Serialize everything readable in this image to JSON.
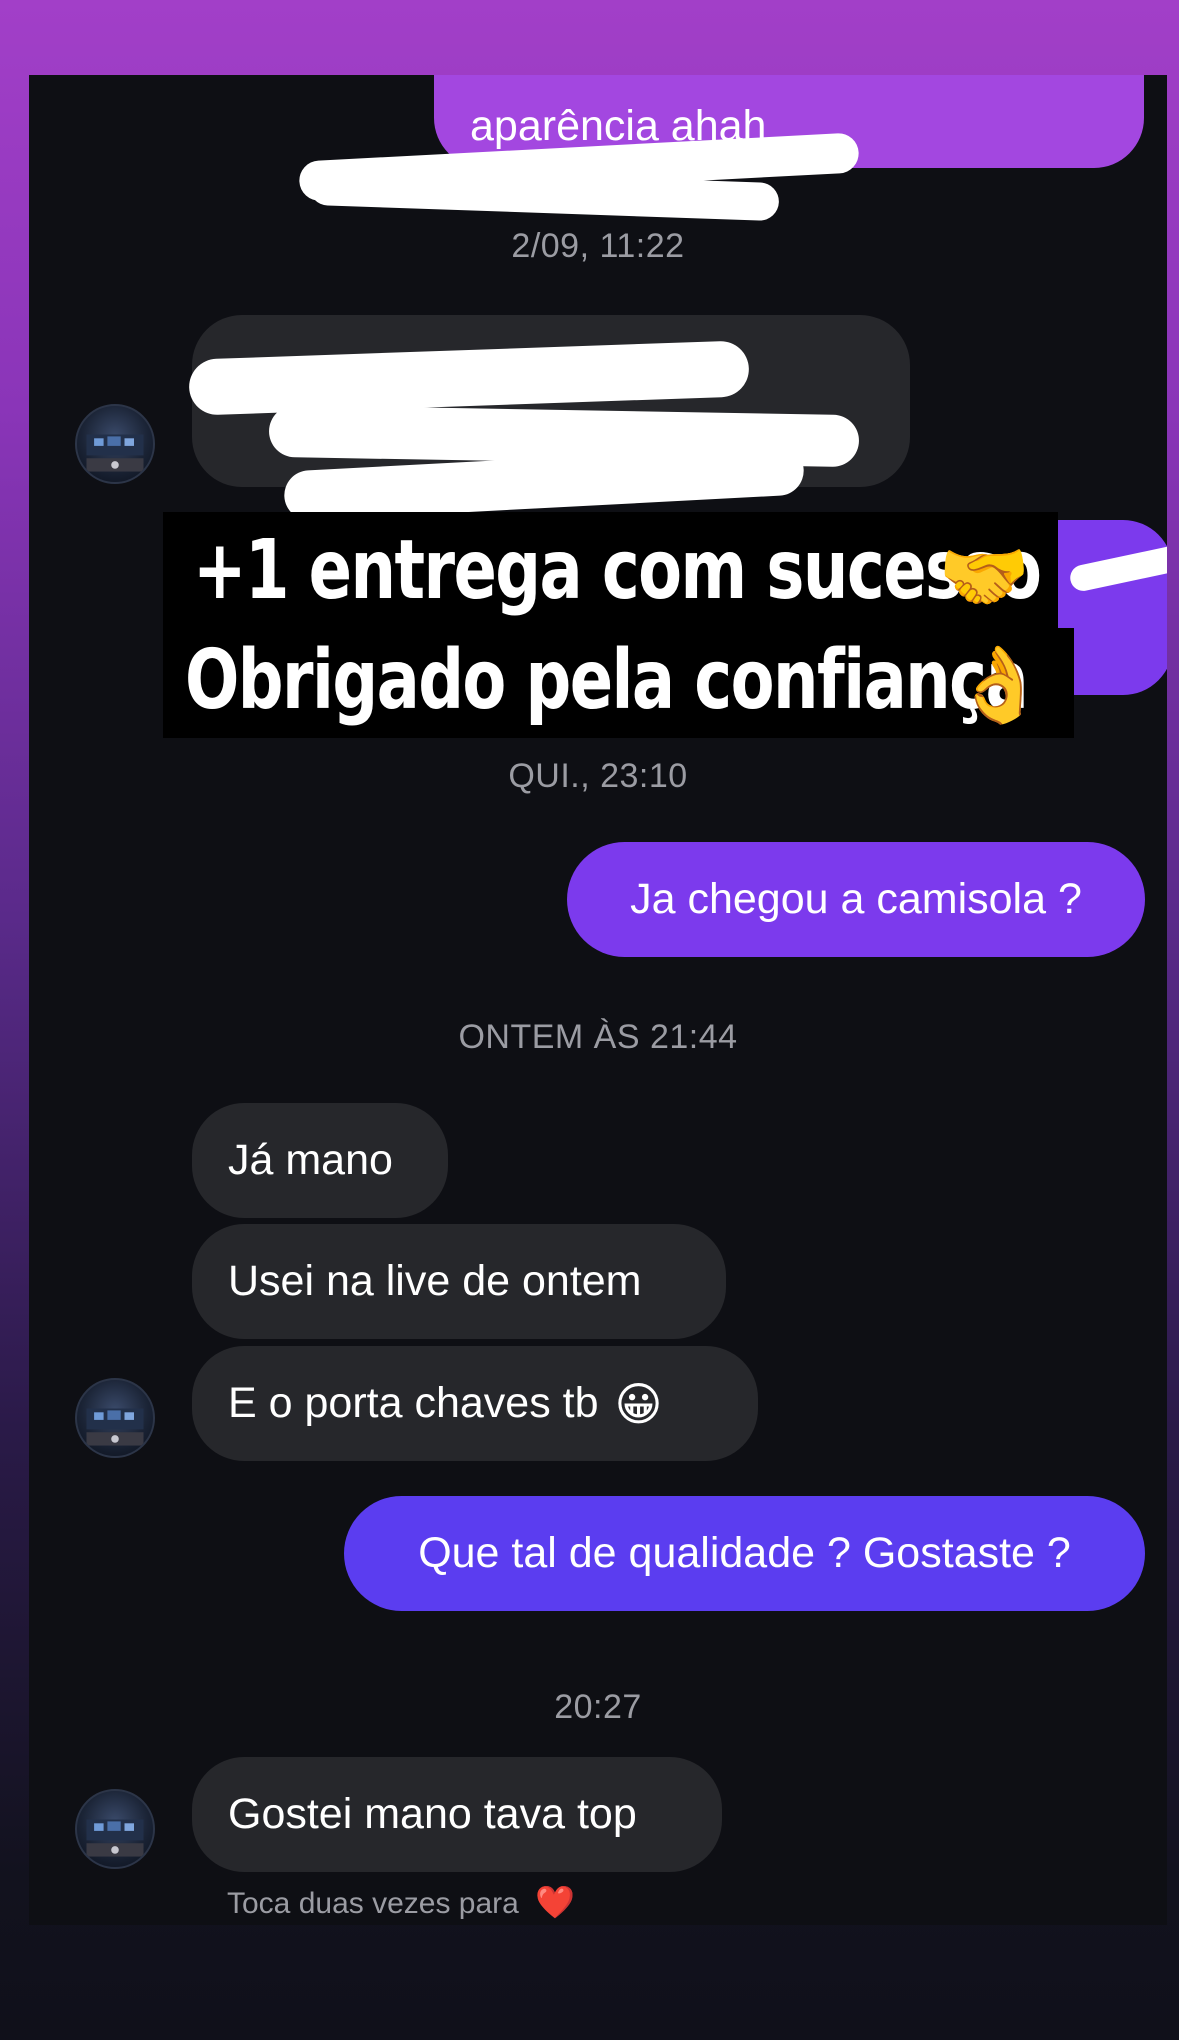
{
  "conversation": {
    "top_partial_message": "aparência ahah",
    "timestamps": {
      "first": "2/09, 11:22",
      "second": "QUI., 23:10",
      "third": "ONTEM ÀS 21:44",
      "fourth": "20:27"
    },
    "messages": {
      "sent_1": "Ja chegou a camisola ?",
      "received_1": "Já mano",
      "received_2": "Usei na live de ontem",
      "received_3": "E o porta chaves tb",
      "sent_2": "Que tal de qualidade ? Gostaste ?",
      "received_4": "Gostei mano tava top"
    },
    "hint": "Toca duas vezes para"
  },
  "overlay_caption": {
    "line1": "+1 entrega com sucesso",
    "line2": "Obrigado pela confiança"
  },
  "emojis": {
    "handshake": "🤝",
    "ok_hand": "👌",
    "grin": "😀",
    "heart": "❤️"
  },
  "colors": {
    "background_top": "#a23fc8",
    "screen_bg": "#0e0f14",
    "incoming_bubble": "#26272b",
    "outgoing_purple": "#7c3aed",
    "outgoing_violet": "#5b3df0",
    "top_bubble": "#a347e0",
    "timestamp_text": "#9b9ca3"
  }
}
